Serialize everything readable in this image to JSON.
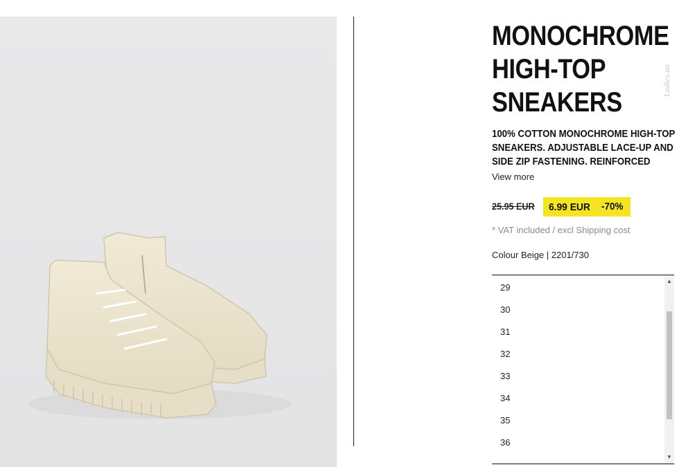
{
  "product": {
    "title_lines": [
      "MONOCHROME",
      "HIGH-TOP",
      "SNEAKERS"
    ],
    "description_lines": [
      "100% COTTON MONOCHROME HIGH-TOP",
      "SNEAKERS. ADJUSTABLE LACE-UP AND",
      "SIDE ZIP FASTENING. REINFORCED"
    ],
    "view_more": "View more",
    "old_price": "25.95 EUR",
    "new_price": "6.99 EUR",
    "discount": "-70%",
    "vat_note": "* VAT included / excl Shipping cost",
    "colour_line": "Colour Beige | 2201/730",
    "image_alt": "beige high-top sneakers"
  },
  "sizes": {
    "items": [
      "29",
      "30",
      "31",
      "32",
      "33",
      "34",
      "35",
      "36"
    ]
  },
  "watermark": "Ladies.ua",
  "colors": {
    "price_badge": "#f5e421",
    "shoe": "#efe8d3",
    "photo_bg": "#e8e8e9"
  },
  "icons": {
    "scroll_up": "triangle-up",
    "scroll_down": "triangle-down"
  }
}
